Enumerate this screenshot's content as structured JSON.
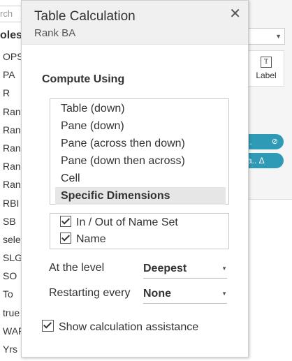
{
  "background": {
    "search_placeholder": "rch",
    "tables_heading": "oles",
    "fields": [
      "OPS",
      "PA",
      "R",
      "Ran",
      "Ran",
      "Ran",
      "Ran",
      "Ran",
      "RBI",
      "SB",
      "sele",
      "SLG",
      "SO",
      "To",
      "true",
      "WAR",
      "Yrs"
    ],
    "label_card": "Label",
    "pill_1": "..",
    "pill_2": "a.. Δ"
  },
  "dialog": {
    "title": "Table Calculation",
    "subtitle": "Rank BA",
    "close_label": "✕",
    "compute_using": {
      "heading": "Compute Using",
      "options": [
        "Table (down)",
        "Pane (down)",
        "Pane (across then down)",
        "Pane (down then across)",
        "Cell",
        "Specific Dimensions"
      ],
      "selected": "Specific Dimensions"
    },
    "dimensions": [
      {
        "label": "In / Out of Name Set",
        "checked": true
      },
      {
        "label": "Name",
        "checked": true
      }
    ],
    "at_level": {
      "label": "At the level",
      "value": "Deepest"
    },
    "restarting": {
      "label": "Restarting every",
      "value": "None"
    },
    "assistance": {
      "label": "Show calculation assistance",
      "checked": true
    }
  },
  "colors": {
    "accent_pill": "#2f9ab5",
    "selected_row": "#e6e6e6"
  }
}
